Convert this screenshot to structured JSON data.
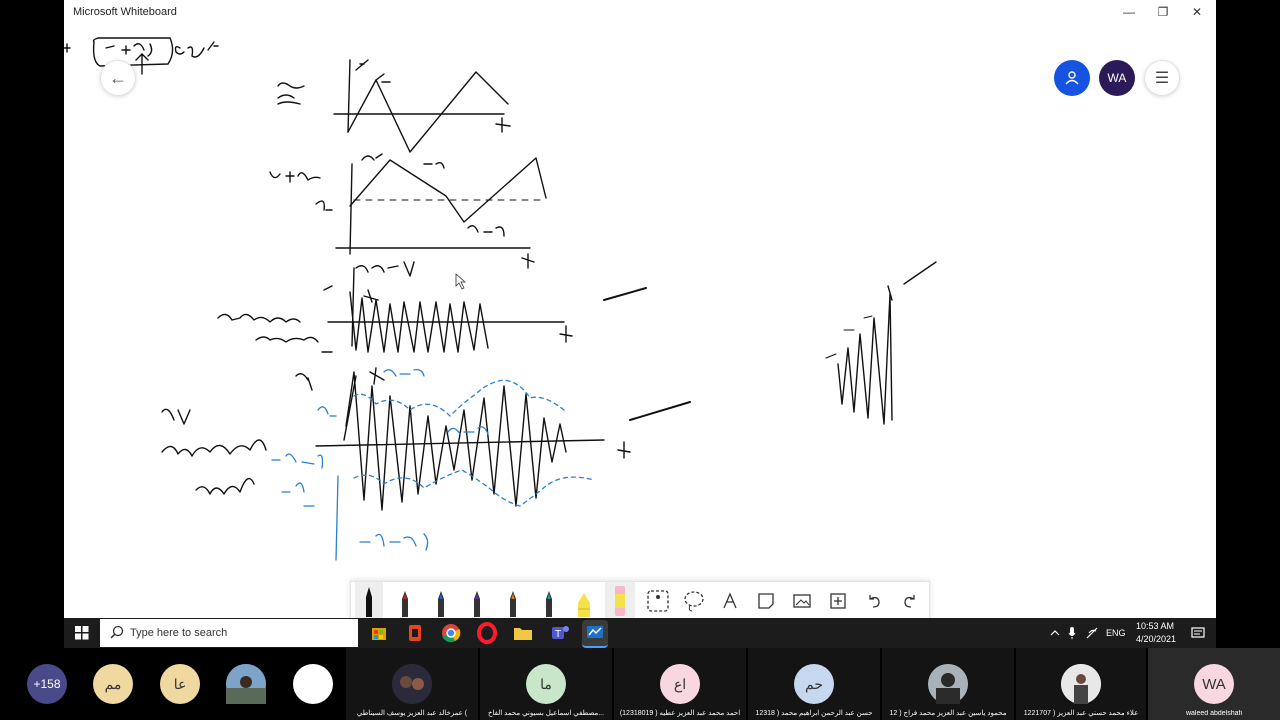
{
  "app": {
    "title": "Microsoft Whiteboard",
    "window_controls": [
      "—",
      "❐",
      "✕"
    ]
  },
  "header": {
    "back_icon": "arrow-left-icon",
    "share_icon": "person-add-icon",
    "user_initials": "WA",
    "menu_icon": "hamburger-icon",
    "colors": {
      "share_bg": "#1653e0",
      "avatar_bg": "#2b1a57"
    }
  },
  "toolbar": {
    "tools": [
      "pen-black",
      "pen-red",
      "pen-blue",
      "pen-purple",
      "pen-orange",
      "pen-teal",
      "highlighter-yellow",
      "ruler-pink",
      "lasso-select",
      "lasso",
      "text",
      "sticky-note",
      "image",
      "insert",
      "undo",
      "redo"
    ]
  },
  "taskbar": {
    "search_placeholder": "Type here to search",
    "language": "ENG",
    "time": "10:53 AM",
    "date": "4/20/2021"
  },
  "participants": {
    "more_count": "+158",
    "small_circles": [
      "مم",
      "عا"
    ],
    "tiles": [
      {
        "initials": "",
        "name": "عمرخالد عبد العزيز يوسف السيناطي ("
      },
      {
        "initials": "ما",
        "name": "مصطفي اسماعيل بسيوني محمد الفاخ..."
      },
      {
        "initials": "اع",
        "name": "احمد محمد عبد العزيز عطيه ( 12318019)"
      },
      {
        "initials": "حم",
        "name": "حسن عبد الرحمن ابراهيم محمد ( 12318"
      },
      {
        "initials": "",
        "name": "محمود ياسين عبد العزيز محمد فراج ( 12"
      },
      {
        "initials": "",
        "name": "علاء محمد حسني عبد العزيز ( 1221707"
      },
      {
        "initials": "WA",
        "name": "waleed abdelshafi"
      }
    ]
  }
}
